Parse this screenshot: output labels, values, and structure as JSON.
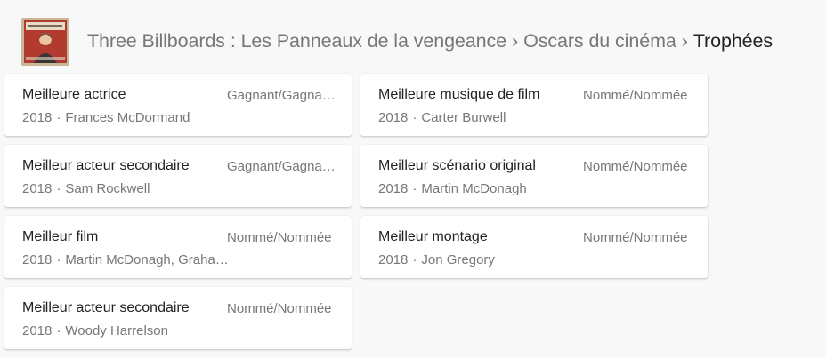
{
  "breadcrumb": {
    "film": "Three Billboards : Les Panneaux de la vengeance",
    "section": "Oscars du cinéma",
    "current": "Trophées",
    "separator": "›"
  },
  "awards": [
    {
      "category": "Meilleure actrice",
      "result": "Gagnant/Gagnante",
      "year": "2018",
      "person": "Frances McDormand"
    },
    {
      "category": "Meilleure musique de film",
      "result": "Nommé/Nommée",
      "year": "2018",
      "person": "Carter Burwell"
    },
    {
      "category": "Meilleur acteur secondaire",
      "result": "Gagnant/Gagnante",
      "year": "2018",
      "person": "Sam Rockwell"
    },
    {
      "category": "Meilleur scénario original",
      "result": "Nommé/Nommée",
      "year": "2018",
      "person": "Martin McDonagh"
    },
    {
      "category": "Meilleur film",
      "result": "Nommé/Nommée",
      "year": "2018",
      "person": "Martin McDonagh, Graham Broadbent, Pete Czernin"
    },
    {
      "category": "Meilleur montage",
      "result": "Nommé/Nommée",
      "year": "2018",
      "person": "Jon Gregory"
    },
    {
      "category": "Meilleur acteur secondaire",
      "result": "Nommé/Nommée",
      "year": "2018",
      "person": "Woody Harrelson"
    }
  ],
  "dot": "·"
}
